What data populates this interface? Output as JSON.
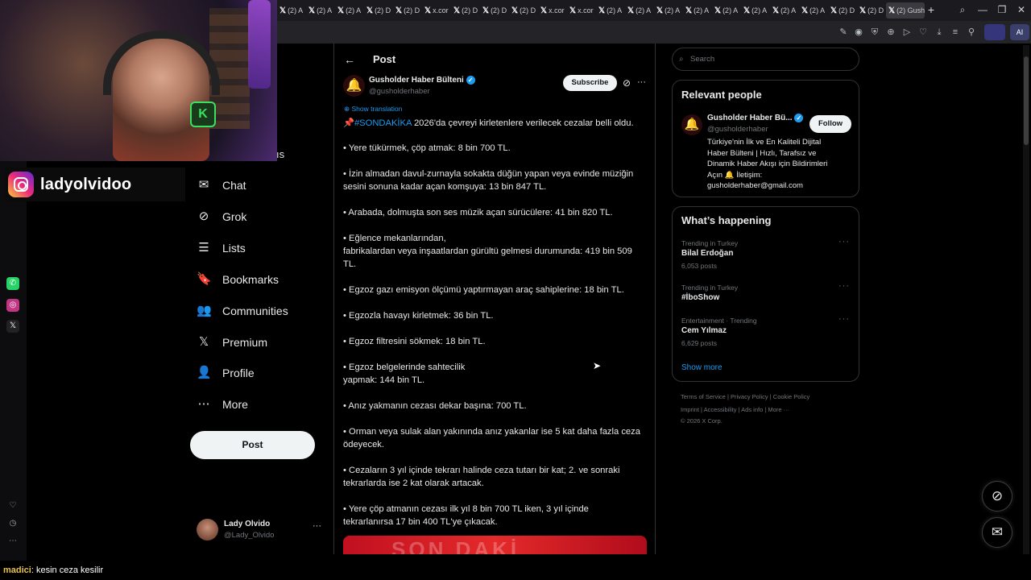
{
  "browser": {
    "tabs": [
      {
        "icon": "x-icon",
        "label": "(2) A"
      },
      {
        "icon": "x-icon",
        "label": "(2) A"
      },
      {
        "icon": "x-icon",
        "label": "(2) A"
      },
      {
        "icon": "x-icon",
        "label": "(2) D"
      },
      {
        "icon": "x-icon",
        "label": "(2) D"
      },
      {
        "icon": "x-icon",
        "label": "x.cor"
      },
      {
        "icon": "x-icon",
        "label": "(2) D"
      },
      {
        "icon": "x-icon",
        "label": "(2) D"
      },
      {
        "icon": "x-icon",
        "label": "(2) D"
      },
      {
        "icon": "x-icon",
        "label": "x.cor"
      },
      {
        "icon": "x-icon",
        "label": "x.cor"
      },
      {
        "icon": "x-icon",
        "label": "(2) A"
      },
      {
        "icon": "x-icon",
        "label": "(2) A"
      },
      {
        "icon": "x-icon",
        "label": "(2) A"
      },
      {
        "icon": "x-icon",
        "label": "(2) A"
      },
      {
        "icon": "x-icon",
        "label": "(2) A"
      },
      {
        "icon": "x-icon",
        "label": "(2) A"
      },
      {
        "icon": "x-icon",
        "label": "(2) A"
      },
      {
        "icon": "x-icon",
        "label": "(2) A"
      },
      {
        "icon": "x-icon",
        "label": "(2) D"
      },
      {
        "icon": "x-icon",
        "label": "(2) D"
      },
      {
        "icon": "x-icon",
        "label": "(2) Gusho",
        "active": true
      }
    ],
    "ai_label": "AI"
  },
  "stream": {
    "instagram_handle": "ladyolvidoo",
    "cam_badge": "K",
    "partial_text": "ıs"
  },
  "nav": {
    "items": [
      {
        "label": "Chat",
        "icon": "chat-icon",
        "glyph": "✉"
      },
      {
        "label": "Grok",
        "icon": "grok-icon",
        "glyph": "⊘"
      },
      {
        "label": "Lists",
        "icon": "lists-icon",
        "glyph": "☰"
      },
      {
        "label": "Bookmarks",
        "icon": "bookmark-icon",
        "glyph": "🔖"
      },
      {
        "label": "Communities",
        "icon": "communities-icon",
        "glyph": "👥"
      },
      {
        "label": "Premium",
        "icon": "x-premium-icon",
        "glyph": "𝕏"
      },
      {
        "label": "Profile",
        "icon": "profile-icon",
        "glyph": "👤"
      },
      {
        "label": "More",
        "icon": "more-icon",
        "glyph": "⋯"
      }
    ],
    "post_button": "Post",
    "account_name": "Lady Olvido",
    "account_handle": "@Lady_Olvido"
  },
  "post": {
    "header_title": "Post",
    "author_name": "Gusholder Haber Bülteni",
    "author_handle": "@gusholderhaber",
    "subscribe_label": "Subscribe",
    "show_translation": "Show translation",
    "hashtag": "#SONDAKİKA",
    "lines": [
      {
        "text": "2026'da çevreyi kirletenlere verilecek cezalar belli oldu."
      },
      {
        "text": "• Yere tükürmek, çöp atmak: 8 bin 700 TL."
      },
      {
        "text": "• İzin almadan davul-zurnayla sokakta düğün yapan veya evinde müziğin"
      },
      {
        "text": "sesini sonuna kadar açan komşuya: 13 bin 847 TL."
      },
      {
        "text": "• Arabada, dolmuşta son ses müzik açan sürücülere: 41 bin 820 TL."
      },
      {
        "text": "• Eğlence mekanlarından,"
      },
      {
        "text": "fabrikalardan veya inşaatlardan gürültü gelmesi durumunda: 419 bin 509"
      },
      {
        "text": "TL."
      },
      {
        "text": "• Egzoz gazı emisyon ölçümü yaptırmayan araç sahiplerine: 18 bin TL."
      },
      {
        "text": "• Egzozla havayı kirletmek: 36 bin TL."
      },
      {
        "text": "• Egzoz filtresini sökmek: 18 bin TL."
      },
      {
        "text": "• Egzoz belgelerinde sahtecilik"
      },
      {
        "text": "yapmak: 144 bin TL."
      },
      {
        "text": "• Anız yakmanın cezası dekar başına: 700 TL."
      },
      {
        "text": "• Orman veya sulak alan yakınında anız yakanlar ise 5 kat daha fazla ceza"
      },
      {
        "text": "ödeyecek."
      },
      {
        "text": "• Cezaların 3 yıl içinde tekrarı halinde ceza tutarı bir kat; 2. ve sonraki"
      },
      {
        "text": "tekrarlarda ise 2 kat olarak artacak."
      },
      {
        "text": "• Yere çöp atmanın cezası ilk yıl 8 bin 700 TL iken, 3 yıl içinde"
      },
      {
        "text": "tekrarlanırsa 17 bin 400 TL'ye çıkacak."
      }
    ],
    "image_text": "SON DAKİ"
  },
  "sidebar": {
    "search_placeholder": "Search",
    "relevant_title": "Relevant people",
    "person_name": "Gusholder Haber Bü...",
    "person_handle": "@gusholderhaber",
    "follow_label": "Follow",
    "bio": [
      "Türkiye'nin İlk ve En Kaliteli Dijital",
      "Haber Bülteni | Hızlı, Tarafsız ve",
      "Dinamik Haber Akışı için Bildirimleri",
      "Açın 🔔 İletişim:",
      "gusholderhaber@gmail.com"
    ],
    "happening_title": "What’s happening",
    "trends": [
      {
        "context": "Trending in Turkey",
        "name": "Bilal Erdoğan",
        "count": "6,053 posts"
      },
      {
        "context": "Trending in Turkey",
        "name": "#İboShow",
        "count": ""
      },
      {
        "context": "Entertainment · Trending",
        "name": "Cem Yılmaz",
        "count": "6,629 posts"
      }
    ],
    "show_more": "Show more",
    "footer_row1": [
      "Terms of Service",
      "Privacy Policy",
      "Cookie Policy"
    ],
    "footer_row2": [
      "Imprint",
      "Accessibility",
      "Ads info",
      "More ···"
    ],
    "copyright": "© 2026 X Corp."
  },
  "chat_overlay": {
    "user": "madici",
    "message": "kesin ceza kesilir"
  },
  "colors": {
    "accent": "#1d9bf0",
    "background": "#000000",
    "text": "#e7e9ea",
    "muted": "#71767b"
  }
}
